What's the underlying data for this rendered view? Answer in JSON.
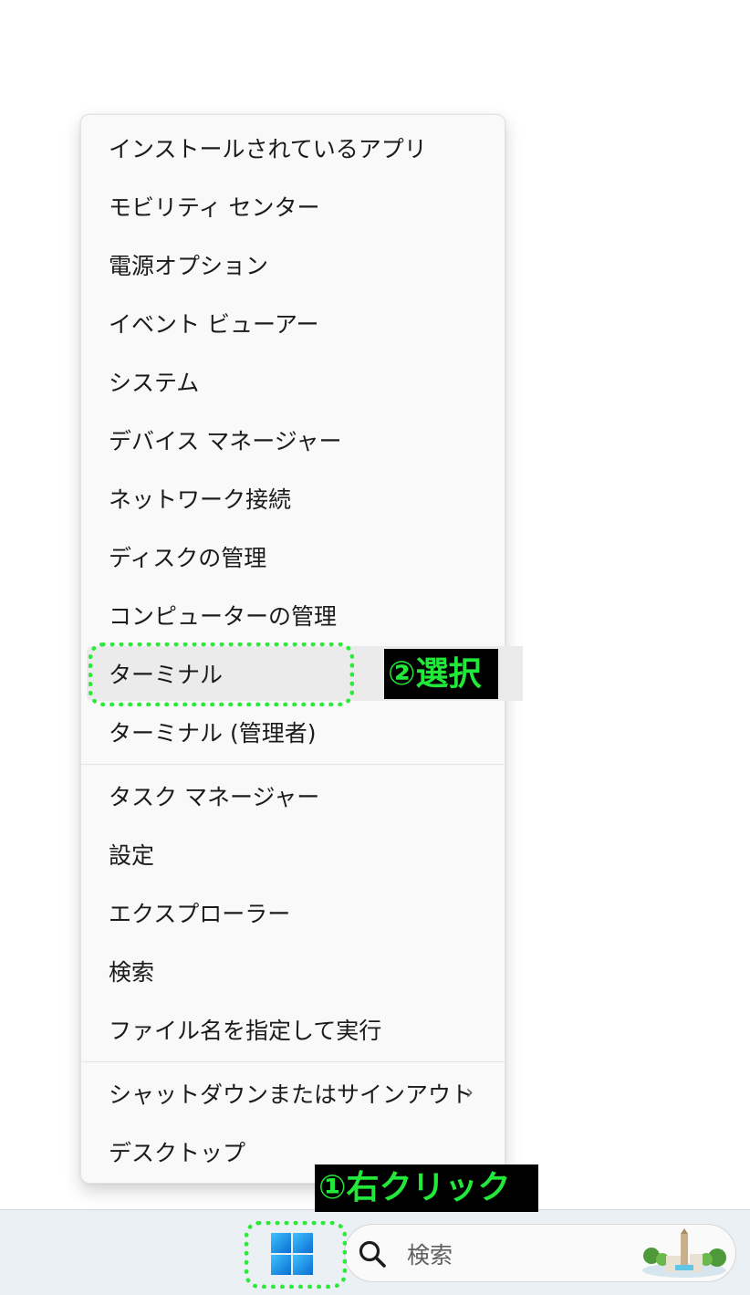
{
  "context_menu": {
    "items": [
      {
        "label": "インストールされているアプリ"
      },
      {
        "label": "モビリティ センター"
      },
      {
        "label": "電源オプション"
      },
      {
        "label": "イベント ビューアー"
      },
      {
        "label": "システム"
      },
      {
        "label": "デバイス マネージャー"
      },
      {
        "label": "ネットワーク接続"
      },
      {
        "label": "ディスクの管理"
      },
      {
        "label": "コンピューターの管理"
      },
      {
        "label": "ターミナル",
        "highlighted": true
      },
      {
        "label": "ターミナル (管理者)"
      },
      {
        "label": "タスク マネージャー"
      },
      {
        "label": "設定"
      },
      {
        "label": "エクスプローラー"
      },
      {
        "label": "検索"
      },
      {
        "label": "ファイル名を指定して実行"
      },
      {
        "label": "シャットダウンまたはサインアウト",
        "has_submenu": true
      },
      {
        "label": "デスクトップ"
      }
    ],
    "submenu_chevron": "›"
  },
  "taskbar": {
    "start_icon": "windows-logo-icon",
    "search": {
      "placeholder": "検索",
      "icon": "search-icon"
    }
  },
  "annotations": {
    "step1": "①右クリック",
    "step2": "②選択",
    "color": "#22e83a"
  }
}
